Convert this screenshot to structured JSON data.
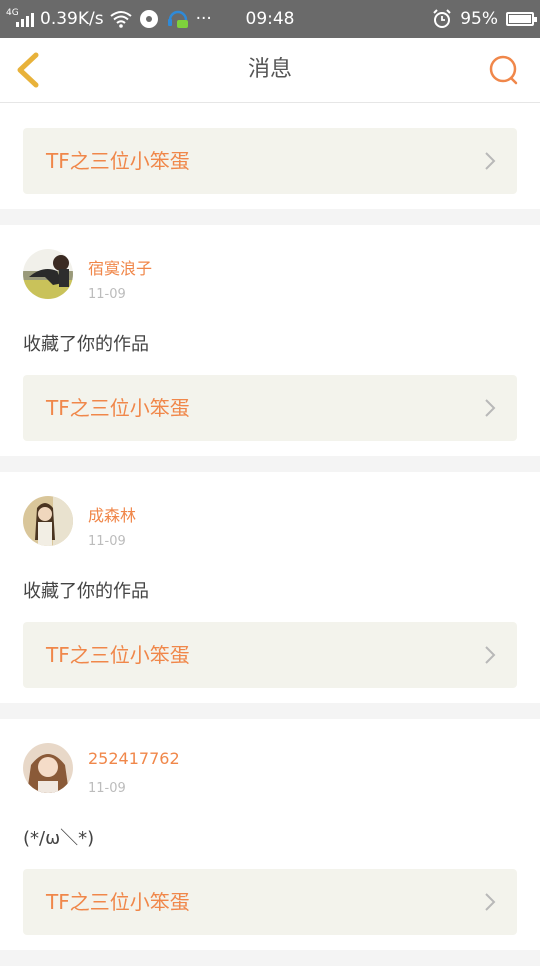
{
  "status_bar": {
    "network": "4G",
    "speed": "0.39K/s",
    "time": "09:48",
    "battery": "95%"
  },
  "header": {
    "title": "消息"
  },
  "top_item": {
    "target_label": "TF之三位小笨蛋"
  },
  "items": [
    {
      "name": "宿寞浪子",
      "date": "11-09",
      "message": "收藏了你的作品",
      "target_label": "TF之三位小笨蛋"
    },
    {
      "name": "成森林",
      "date": "11-09",
      "message": "收藏了你的作品",
      "target_label": "TF之三位小笨蛋"
    },
    {
      "name": "252417762",
      "date": "11-09",
      "message": "(*/ω＼*)",
      "target_label": "TF之三位小笨蛋"
    }
  ],
  "colors": {
    "accent": "#f0874a",
    "back_arrow": "#e8b23a",
    "row_bg": "#f3f3ec"
  }
}
